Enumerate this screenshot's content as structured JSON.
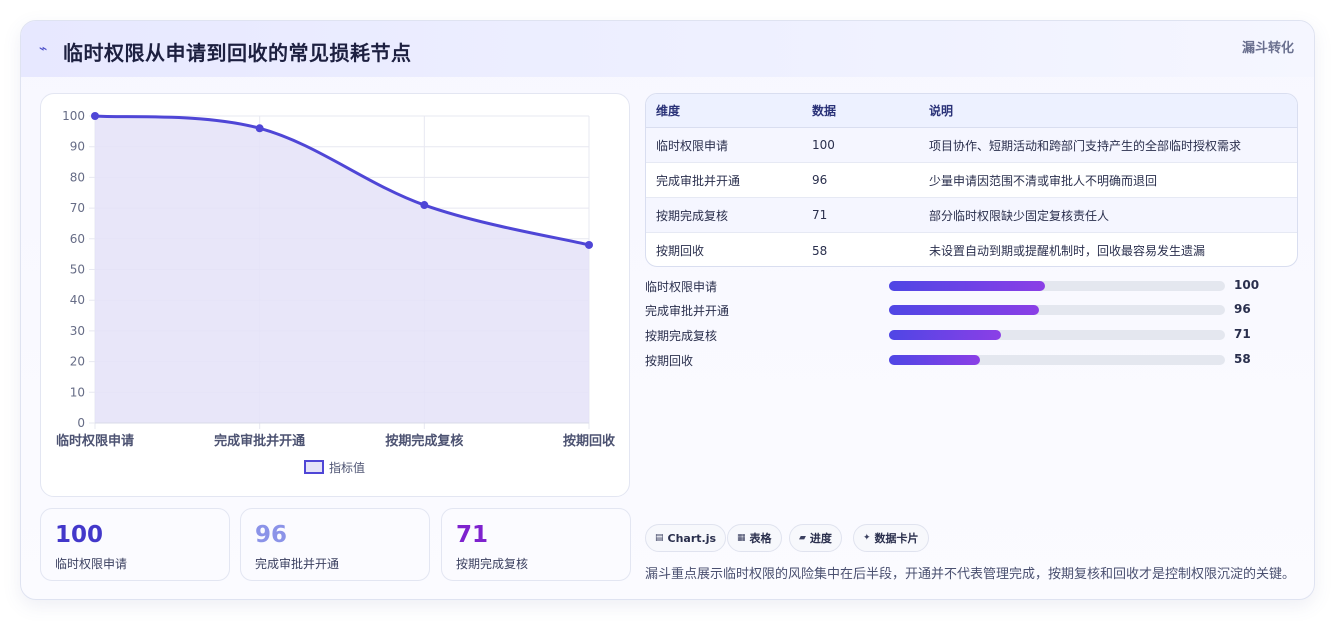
{
  "header": {
    "icon": "trend-line-icon",
    "title": "临时权限从申请到回收的常见损耗节点",
    "tag": "漏斗转化"
  },
  "chart_data": {
    "type": "area",
    "categories": [
      "临时权限申请",
      "完成审批并开通",
      "按期完成复核",
      "按期回收"
    ],
    "series": [
      {
        "name": "指标值",
        "values": [
          100,
          96,
          71,
          58
        ]
      }
    ],
    "ylim": [
      0,
      100
    ],
    "yticks": [
      "0",
      "10",
      "20",
      "30",
      "40",
      "50",
      "60",
      "70",
      "80",
      "90",
      "100"
    ],
    "grid": true,
    "legend": "bottom",
    "colors": {
      "line": "#4f46d6",
      "fill": "#e4e2f8"
    }
  },
  "stats": [
    {
      "value": "100",
      "label": "临时权限申请",
      "color": "#4338ca"
    },
    {
      "value": "96",
      "label": "完成审批并开通",
      "color": "#8b93e8"
    },
    {
      "value": "71",
      "label": "按期完成复核",
      "color": "#7e22ce"
    }
  ],
  "table": {
    "headers": [
      "维度",
      "数据",
      "说明"
    ],
    "rows": [
      [
        "临时权限申请",
        "100",
        "项目协作、短期活动和跨部门支持产生的全部临时授权需求"
      ],
      [
        "完成审批并开通",
        "96",
        "少量申请因范围不清或审批人不明确而退回"
      ],
      [
        "按期完成复核",
        "71",
        "部分临时权限缺少固定复核责任人"
      ],
      [
        "按期回收",
        "58",
        "未设置自动到期或提醒机制时，回收最容易发生遗漏"
      ]
    ]
  },
  "progress": [
    {
      "label": "临时权限申请",
      "value": "100",
      "fraction": 0.463
    },
    {
      "label": "完成审批并开通",
      "value": "96",
      "fraction": 0.445
    },
    {
      "label": "按期完成复核",
      "value": "71",
      "fraction": 0.333
    },
    {
      "label": "按期回收",
      "value": "58",
      "fraction": 0.27
    }
  ],
  "chips": [
    {
      "label": "Chart.js",
      "icon": "chart-icon"
    },
    {
      "label": "表格",
      "icon": "table-icon"
    },
    {
      "label": "进度",
      "icon": "progress-icon"
    },
    {
      "label": "数据卡片",
      "icon": "sparkle-icon"
    }
  ],
  "footnote": "漏斗重点展示临时权限的风险集中在后半段，开通并不代表管理完成，按期复核和回收才是控制权限沉淀的关键。"
}
